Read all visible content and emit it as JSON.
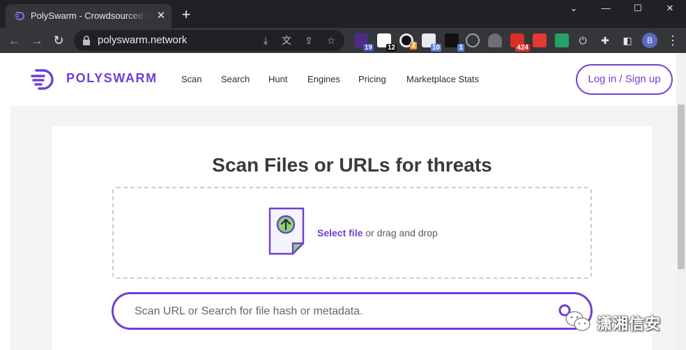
{
  "browser": {
    "tab_title": "PolySwarm - Crowdsourced threat detection",
    "tab_close": "✕",
    "new_tab": "+",
    "window_controls": {
      "minimize": "⌄",
      "restore": "—",
      "maximize": "☐",
      "close": "✕"
    },
    "url": "polyswarm.network",
    "extension_badges": [
      "19",
      "12",
      "2",
      "10",
      "1",
      "424"
    ],
    "profile_initial": "B"
  },
  "site": {
    "logo_text": "POLYSWARM",
    "nav": [
      "Scan",
      "Search",
      "Hunt",
      "Engines",
      "Pricing",
      "Marketplace Stats"
    ],
    "login_label": "Log in / Sign up",
    "accent_color": "#6c3fd4"
  },
  "main": {
    "title": "Scan Files or URLs for threats",
    "select_file": "Select file",
    "drag_drop": " or drag and drop",
    "search_placeholder": "Scan URL or Search for file hash or metadata."
  },
  "watermark": {
    "text": "潇湘信安"
  }
}
